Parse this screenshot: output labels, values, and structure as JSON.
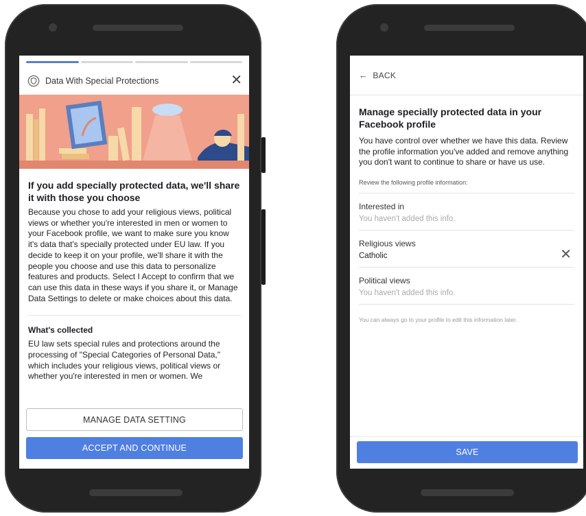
{
  "left_screen": {
    "dialog_title": "Data With Special Protections",
    "heading": "If you add specially protected data, we'll share it with those you choose",
    "body": "Because you chose to add your religious views, political views or whether you're interested in men or women to your Facebook profile, we want to make sure you know it's data that's specially protected under EU law. If you decide to keep it on your profile, we'll share it with the people you choose and use this data to personalize features and products. Select I Accept to confirm that we can use this data in these ways if you share it, or Manage Data Settings to delete or make choices about this data.",
    "section_heading": "What's collected",
    "section_body": "EU law sets special rules and protections around the processing of \"Special Categories of Personal Data,\" which includes your religious views, political views or whether you're interested in men or women. We",
    "manage_button": "MANAGE DATA SETTING",
    "accept_button": "ACCEPT AND CONTINUE",
    "progress": {
      "total_steps": 4,
      "current_step": 1
    }
  },
  "right_screen": {
    "back_label": "BACK",
    "heading": "Manage specially protected data in your Facebook profile",
    "body": "You have control over whether we have this data. Review the profile information you've added and remove anything you don't want to continue to share or have us use.",
    "review_label": "Review the following profile information:",
    "fields": [
      {
        "label": "Interested in",
        "value": "You haven't added this info."
      },
      {
        "label": "Religious views",
        "value": "Catholic"
      },
      {
        "label": "Political views",
        "value": "You haven't added this info."
      }
    ],
    "note": "You can always go to your profile to edit this information later.",
    "save_button": "SAVE"
  },
  "colors": {
    "accent": "#4f7fe0",
    "banner": "#f0a08b"
  },
  "icons": [
    "shield-icon",
    "close-icon",
    "back-arrow-icon",
    "remove-icon"
  ]
}
